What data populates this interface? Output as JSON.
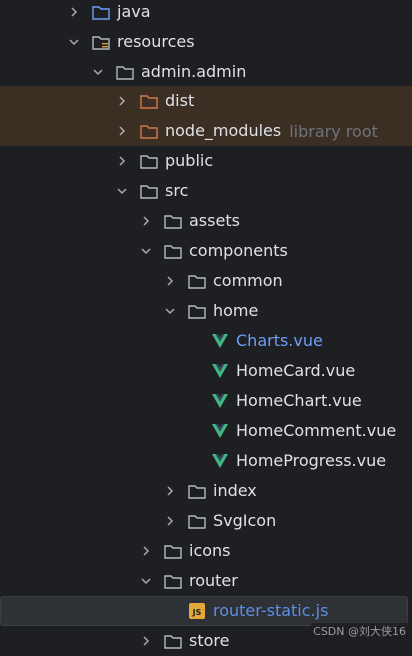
{
  "tree": {
    "java": "java",
    "resources": "resources",
    "admin_admin": "admin.admin",
    "dist": "dist",
    "node_modules": "node_modules",
    "node_modules_hint": "library root",
    "public": "public",
    "src": "src",
    "assets": "assets",
    "components": "components",
    "common": "common",
    "home": "home",
    "charts_vue": "Charts.vue",
    "homecard_vue": "HomeCard.vue",
    "homechart_vue": "HomeChart.vue",
    "homecomment_vue": "HomeComment.vue",
    "homeprogress_vue": "HomeProgress.vue",
    "index": "index",
    "svgicon": "SvgIcon",
    "icons": "icons",
    "router": "router",
    "router_static_js": "router-static.js",
    "store": "store"
  },
  "watermark": "CSDN @刘大侠16",
  "colors": {
    "background": "#1e1f22",
    "excluded_row": "#3b2f24",
    "selected_row": "#2e3136",
    "vue_icon": "#41b883",
    "js_icon": "#e2a93a",
    "blue_text": "#6f9ef8"
  }
}
